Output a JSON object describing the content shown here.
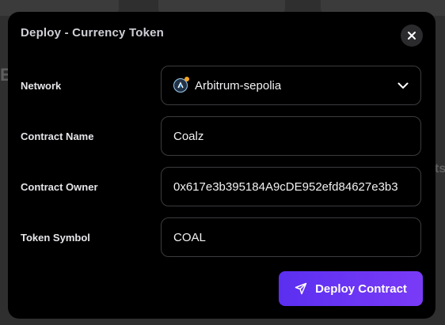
{
  "modal": {
    "title": "Deploy - Currency Token",
    "close_icon": "close-icon"
  },
  "form": {
    "network": {
      "label": "Network",
      "value": "Arbitrum-sepolia",
      "icon": "arbitrum-network-icon",
      "dropdown_icon": "chevron-down-icon"
    },
    "contract_name": {
      "label": "Contract Name",
      "value": "Coalz"
    },
    "contract_owner": {
      "label": "Contract Owner",
      "value": "0x617e3b395184A9cDE952efd84627e3b3"
    },
    "token_symbol": {
      "label": "Token Symbol",
      "value": "COAL"
    }
  },
  "actions": {
    "deploy_label": "Deploy Contract",
    "deploy_icon": "send-icon"
  },
  "colors": {
    "modal_bg": "#000000",
    "field_border": "#3c3c40",
    "accent_start": "#5b2ff0",
    "accent_end": "#7a3bf7"
  }
}
